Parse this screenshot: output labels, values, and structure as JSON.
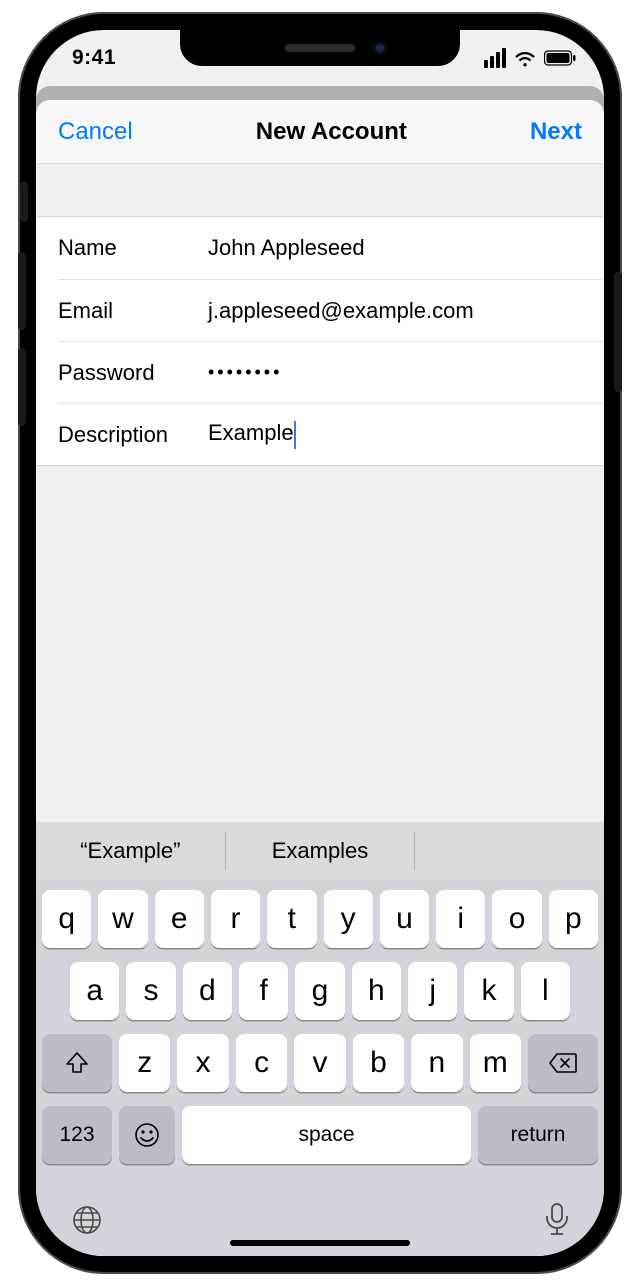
{
  "status": {
    "time": "9:41"
  },
  "nav": {
    "cancel": "Cancel",
    "title": "New Account",
    "next": "Next"
  },
  "form": {
    "name": {
      "label": "Name",
      "value": "John Appleseed"
    },
    "email": {
      "label": "Email",
      "value": "j.appleseed@example.com"
    },
    "password": {
      "label": "Password",
      "value": "••••••••"
    },
    "description": {
      "label": "Description",
      "value": "Example"
    }
  },
  "predictive": {
    "a": "“Example”",
    "b": "Examples"
  },
  "keys": {
    "r1": [
      "q",
      "w",
      "e",
      "r",
      "t",
      "y",
      "u",
      "i",
      "o",
      "p"
    ],
    "r2": [
      "a",
      "s",
      "d",
      "f",
      "g",
      "h",
      "j",
      "k",
      "l"
    ],
    "r3": [
      "z",
      "x",
      "c",
      "v",
      "b",
      "n",
      "m"
    ],
    "num": "123",
    "space": "space",
    "return": "return"
  }
}
